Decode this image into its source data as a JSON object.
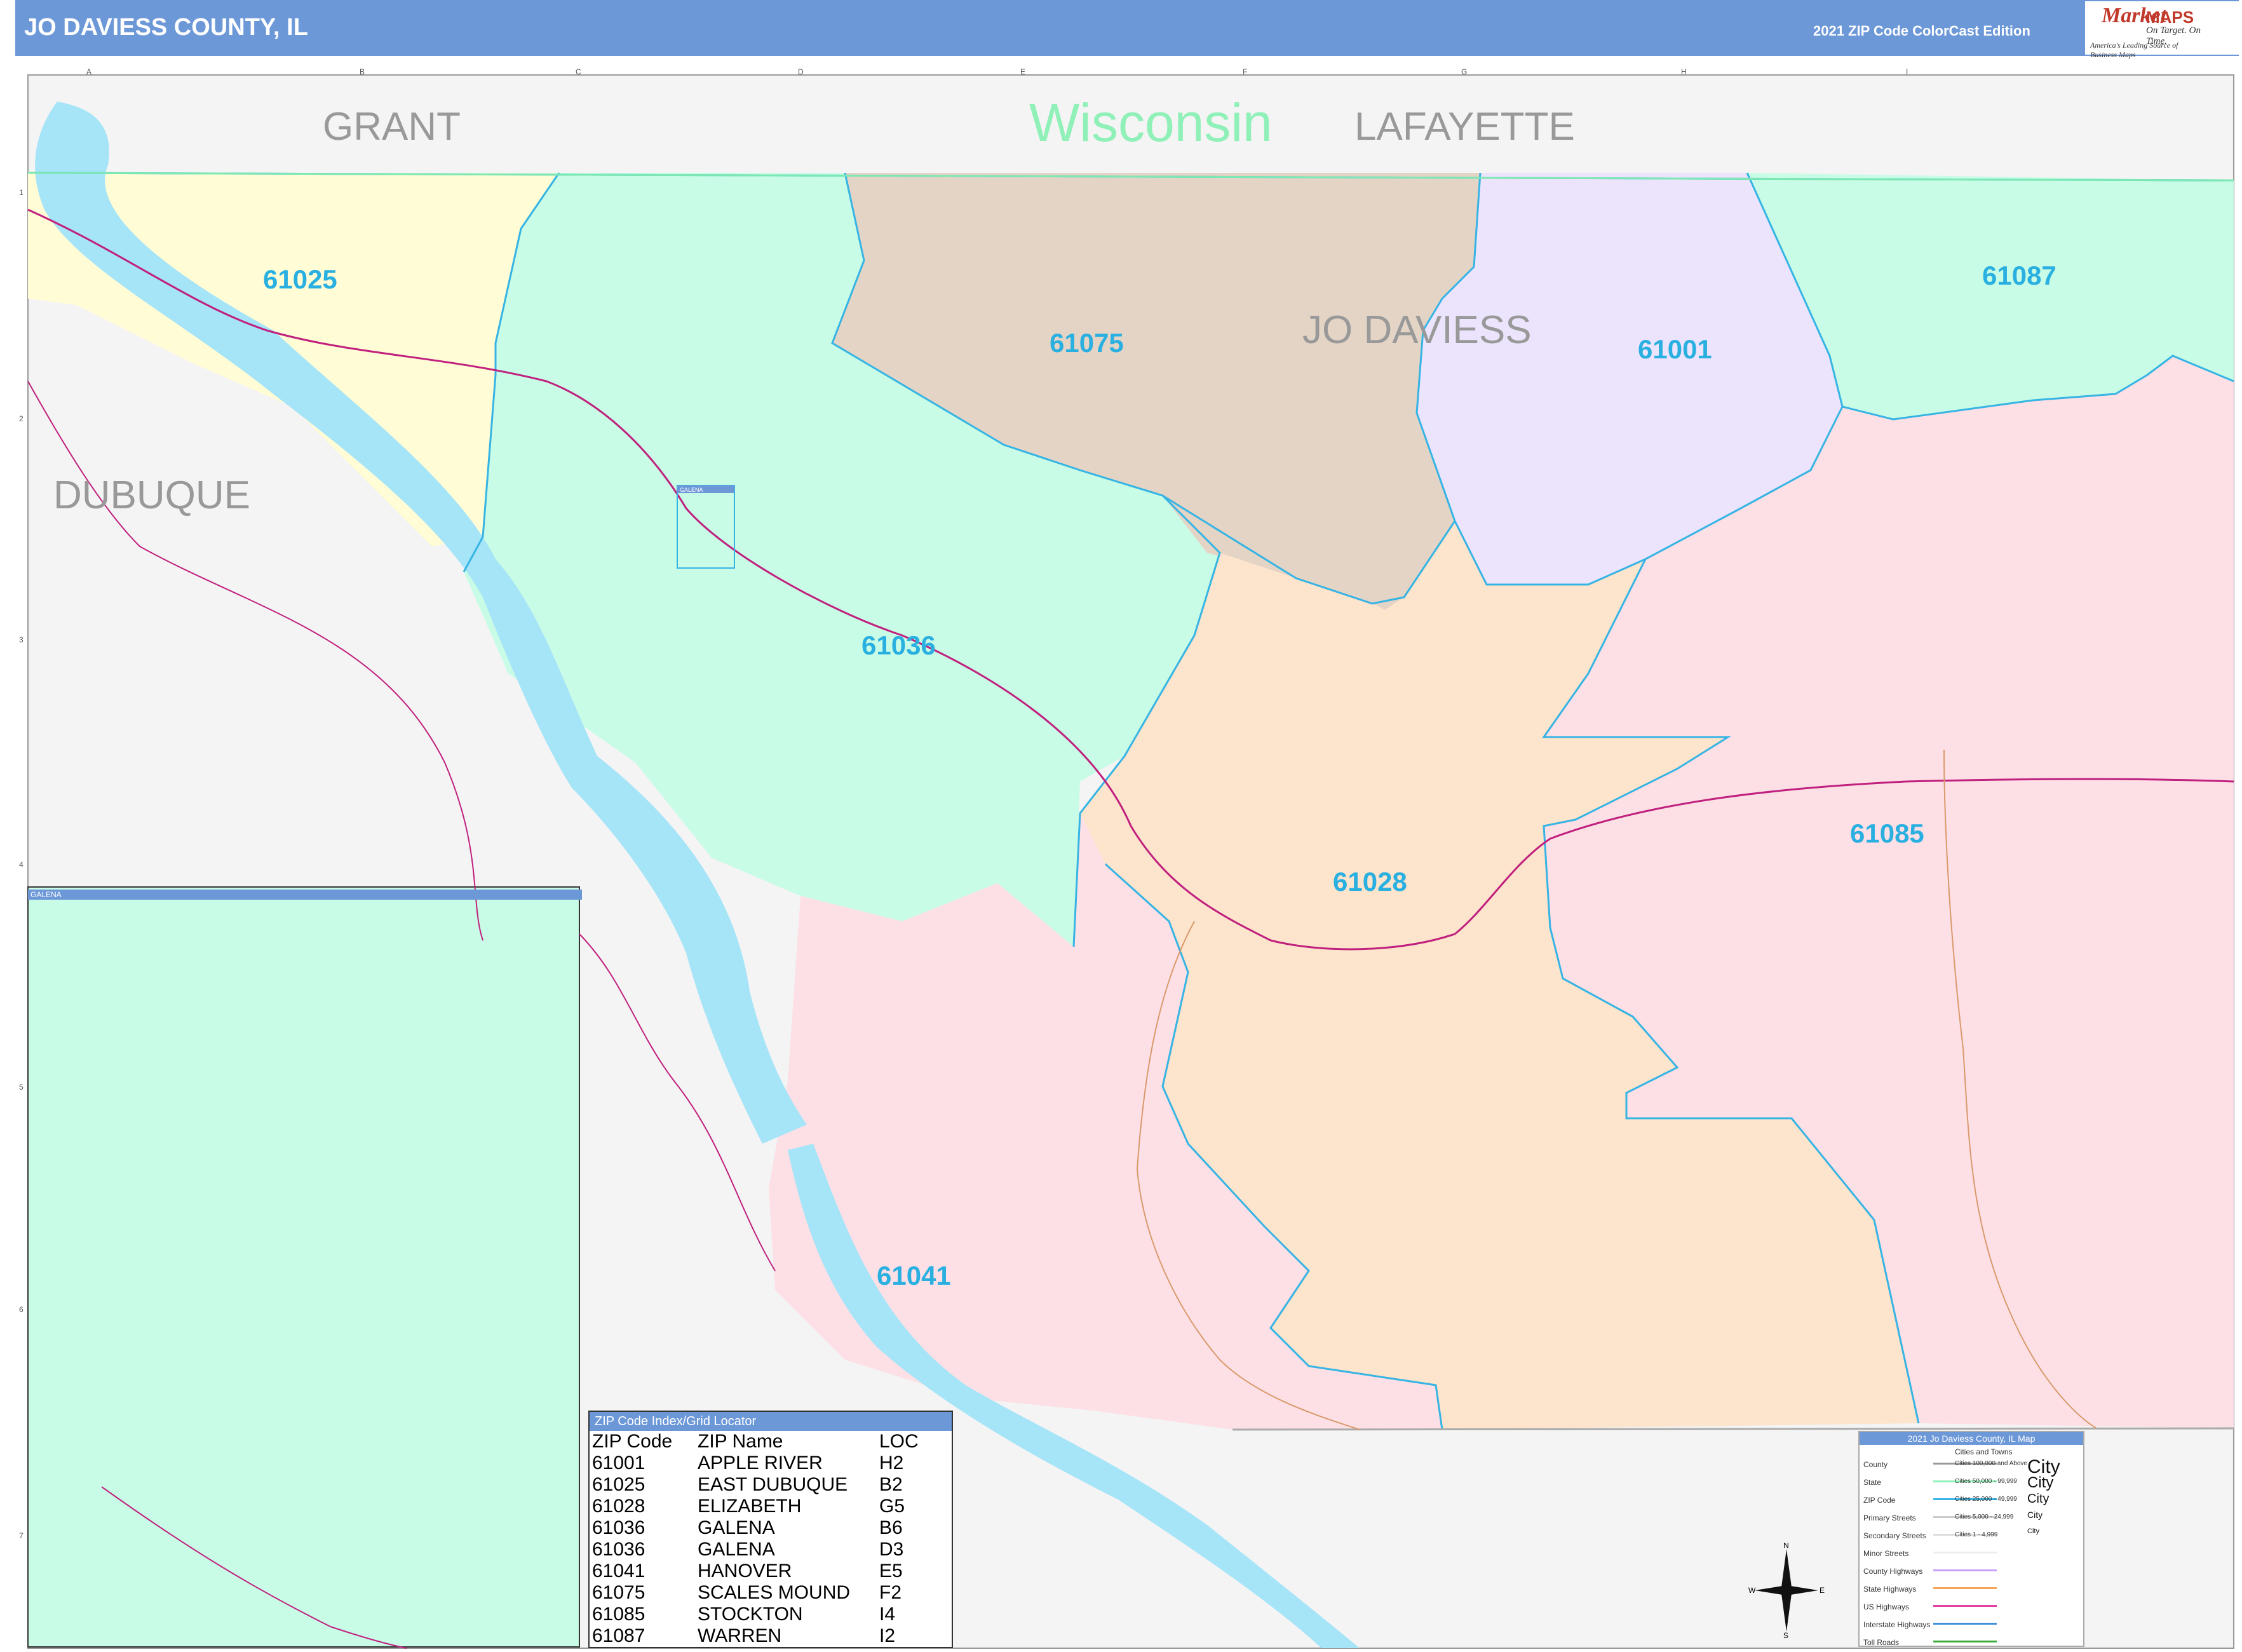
{
  "header": {
    "title": "JO DAVIESS COUNTY, IL",
    "edition": "2021 ZIP Code ColorCast Edition",
    "logo": {
      "brand_mark": "Market",
      "brand_word": "MAPS",
      "tagline": "On Target. On Time.",
      "subtitle": "America's Leading Source of Business Maps"
    }
  },
  "grid": {
    "columns": [
      "A",
      "B",
      "C",
      "D",
      "E",
      "F",
      "G",
      "H",
      "I"
    ],
    "rows": [
      "1",
      "2",
      "3",
      "4",
      "5",
      "6",
      "7"
    ]
  },
  "map": {
    "state_label": "Wisconsin",
    "county_labels": {
      "grant": "GRANT",
      "lafayette": "LAFAYETTE",
      "dubuque": "DUBUQUE",
      "jo_daviess": "JO DAVIESS"
    },
    "zip_labels": {
      "z61025": "61025",
      "z61075": "61075",
      "z61001": "61001",
      "z61087": "61087",
      "z61036": "61036",
      "z61028": "61028",
      "z61085": "61085",
      "z61041": "61041"
    },
    "colors": {
      "z61025": "#fffcd6",
      "z61036": "#c9fce6",
      "z61075": "#e4d4c6",
      "z61001": "#ece4fc",
      "z61087": "#c9fce6",
      "z61028": "#fde4cc",
      "z61085": "#fde0e6",
      "z61041": "#fde0e6",
      "water": "#a6e4f8",
      "outside": "#f4f4f4",
      "zip_border": "#36b4e4",
      "highway": "#c0207e"
    },
    "inset_label": "GALENA",
    "inset_mini_label": "GALENA"
  },
  "zip_index": {
    "title": "ZIP Code Index/Grid Locator",
    "headers": [
      "ZIP Code",
      "ZIP Name",
      "LOC"
    ],
    "rows": [
      [
        "61001",
        "APPLE RIVER",
        "H2"
      ],
      [
        "61025",
        "EAST DUBUQUE",
        "B2"
      ],
      [
        "61028",
        "ELIZABETH",
        "G5"
      ],
      [
        "61036",
        "GALENA",
        "B6"
      ],
      [
        "61036",
        "GALENA",
        "D3"
      ],
      [
        "61041",
        "HANOVER",
        "E5"
      ],
      [
        "61075",
        "SCALES MOUND",
        "F2"
      ],
      [
        "61085",
        "STOCKTON",
        "I4"
      ],
      [
        "61087",
        "WARREN",
        "I2"
      ]
    ]
  },
  "legend": {
    "title": "2021 Jo Daviess County, IL Map",
    "cities_header": "Cities and Towns",
    "items": [
      "County",
      "State",
      "ZIP Code",
      "Primary Streets",
      "Secondary Streets",
      "Minor Streets",
      "County Highways",
      "State Highways",
      "US Highways",
      "Interstate Highways",
      "Toll Roads"
    ],
    "cities": [
      "Cities 100,000 and Above",
      "Cities 50,000 - 99,999",
      "Cities 25,000 - 49,999",
      "Cities 5,000 - 24,999",
      "Cities 1 - 4,999"
    ],
    "city_word": "City"
  },
  "compass": {
    "n": "N",
    "s": "S",
    "e": "E",
    "w": "W"
  }
}
